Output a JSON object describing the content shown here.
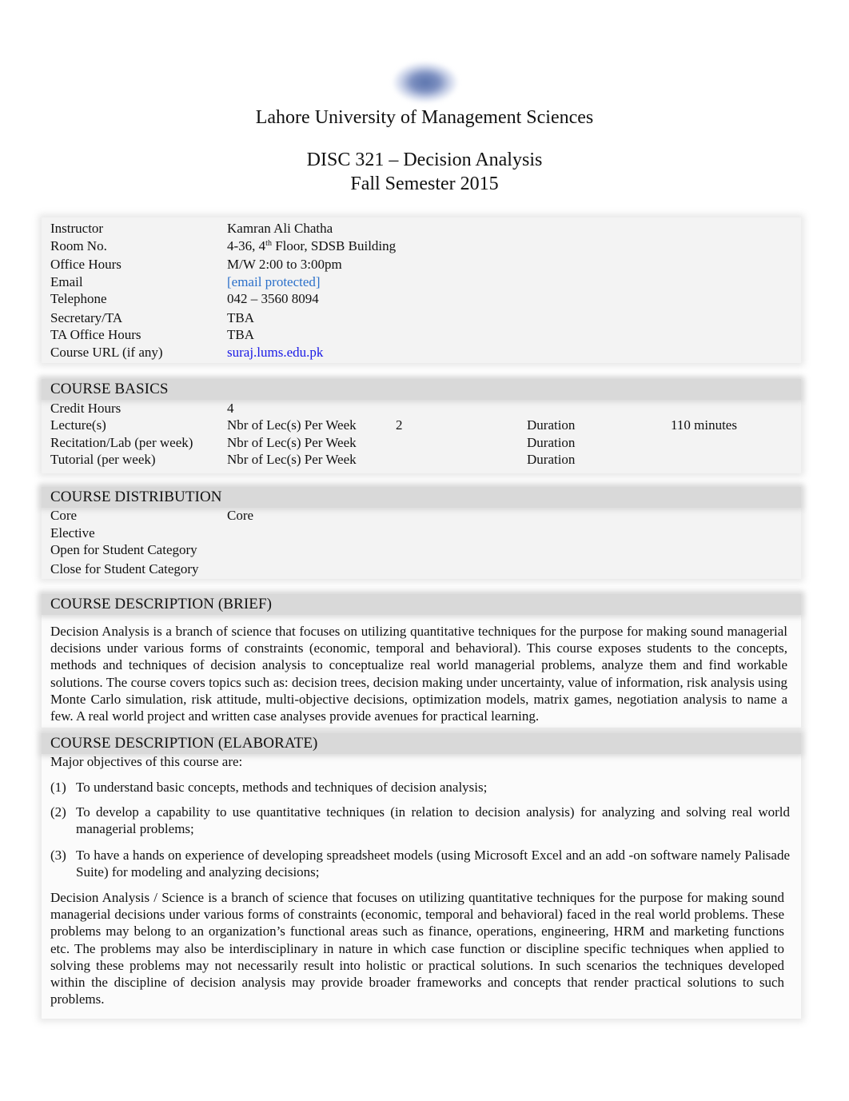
{
  "header": {
    "logo": "lums-logo",
    "university": "Lahore University of Management Sciences",
    "course_title": "DISC 321 – Decision Analysis",
    "semester": "Fall Semester 2015"
  },
  "instructor_info": {
    "rows": [
      {
        "label": "Instructor",
        "value": "Kamran Ali Chatha"
      },
      {
        "label": "Room No.",
        "value_pre": "4-36, 4",
        "value_sup": "th",
        "value_post": " Floor, SDSB Building"
      },
      {
        "label": "Office Hours",
        "value": "M/W 2:00 to 3:00pm"
      },
      {
        "label": "Email",
        "value": "[email protected]"
      },
      {
        "label": "Telephone",
        "value": "042 – 3560 8094"
      },
      {
        "label": "Secretary/TA",
        "value": "TBA"
      },
      {
        "label": "TA Office Hours",
        "value": "TBA"
      },
      {
        "label": "Course URL (if any)",
        "value": "suraj.lums.edu.pk"
      }
    ],
    "link_colors": {
      "email": "#2a6fc9",
      "url": "#1a1ae6"
    }
  },
  "course_basics": {
    "heading": "COURSE BASICS",
    "credit_hours_label": "Credit Hours",
    "credit_hours_value": "4",
    "rows": [
      {
        "label": "Lecture(s)",
        "nbr_label": "Nbr of Lec(s) Per Week",
        "nbr_value": "2",
        "duration_label": "Duration",
        "duration_value": "110 minutes"
      },
      {
        "label": "Recitation/Lab (per week)",
        "nbr_label": "Nbr of Lec(s) Per Week",
        "nbr_value": "",
        "duration_label": "Duration",
        "duration_value": ""
      },
      {
        "label": "Tutorial (per week)",
        "nbr_label": "Nbr of Lec(s) Per Week",
        "nbr_value": "",
        "duration_label": "Duration",
        "duration_value": ""
      }
    ]
  },
  "course_distribution": {
    "heading": "COURSE DISTRIBUTION",
    "rows": [
      {
        "label": "Core",
        "value": "Core"
      },
      {
        "label": "Elective",
        "value": ""
      },
      {
        "label": "Open for Student Category",
        "value": ""
      },
      {
        "label": "Close for Student Category",
        "value": ""
      }
    ]
  },
  "description_brief": {
    "heading": "COURSE DESCRIPTION (BRIEF)",
    "text": "Decision Analysis is a branch of science that focuses on utilizing quantitative techniques for the purpose for making sound managerial decisions under various forms of constraints (economic, temporal and behavioral). This course exposes students to the concepts, methods and techniques of decision analysis to conceptualize real world managerial problems, analyze them and find workable solutions. The course covers topics such as: decision trees, decision making under uncertainty, value of information, risk analysis using Monte Carlo simulation, risk attitude, multi-objective decisions, optimization models, matrix games, negotiation analysis to name a few. A real world project and written case analyses provide avenues for practical learning."
  },
  "description_elaborate": {
    "heading": "COURSE DESCRIPTION (ELABORATE)",
    "intro": "Major objectives of this course are:",
    "objectives": [
      {
        "num": "(1)",
        "text": "To understand basic concepts, methods and techniques of decision analysis;"
      },
      {
        "num": "(2)",
        "text": "To develop a capability to use quantitative techniques (in relation to decision analysis) for analyzing and solving real world managerial problems;"
      },
      {
        "num": "(3)",
        "text": "To have a hands on experience of developing spreadsheet models (using Microsoft Excel and an add  -on software namely Palisade Suite) for modeling and analyzing decisions;"
      }
    ],
    "closing": "Decision Analysis / Science is a branch of science that focuses on utilizing quantitative techniques for the purpose for making sound managerial decisions under various forms of constraints (economic, temporal and behavioral) faced in the real world problems. These problems may belong to an organization’s functional areas such as finance, operations, engineering, HRM and marketing functions etc. The problems may also be interdisciplinary in nature in which case function or discipline specific techniques when applied to solving these problems may not necessarily result into holistic or practical solutions. In such scenarios the techniques developed within the discipline of decision analysis may provide broader frameworks and concepts that render practical solutions to such problems."
  }
}
